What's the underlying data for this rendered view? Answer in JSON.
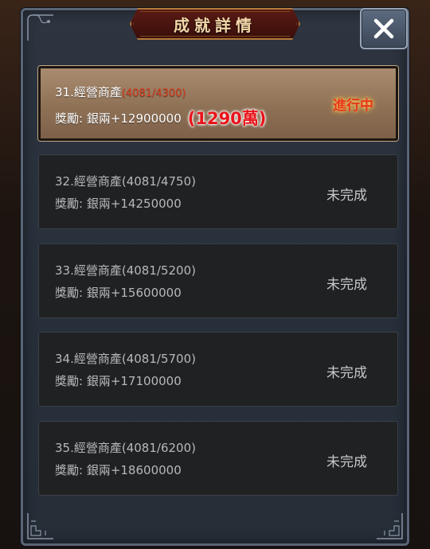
{
  "dialog": {
    "title": "成就詳情",
    "close_glyph": "✕"
  },
  "achievements": [
    {
      "name": "31.經營商產",
      "progress": "(4081/4300)",
      "reward": "獎勵:  銀兩+12900000",
      "annotation": "(1290萬)",
      "status": "進行中",
      "active": true
    },
    {
      "name": "32.經營商產",
      "progress": "(4081/4750)",
      "reward": "獎勵:  銀兩+14250000",
      "status": "未完成",
      "active": false
    },
    {
      "name": "33.經營商產",
      "progress": "(4081/5200)",
      "reward": "獎勵:  銀兩+15600000",
      "status": "未完成",
      "active": false
    },
    {
      "name": "34.經營商產",
      "progress": "(4081/5700)",
      "reward": "獎勵:  銀兩+17100000",
      "status": "未完成",
      "active": false
    },
    {
      "name": "35.經營商產",
      "progress": "(4081/6200)",
      "reward": "獎勵:  銀兩+18600000",
      "status": "未完成",
      "active": false
    }
  ],
  "colors": {
    "active_status": "#e6361c",
    "annotation": "#e8141a",
    "inactive_text": "#b8b8b8"
  },
  "icons": {
    "close": "close-icon",
    "corner": "corner-ornament-icon"
  }
}
